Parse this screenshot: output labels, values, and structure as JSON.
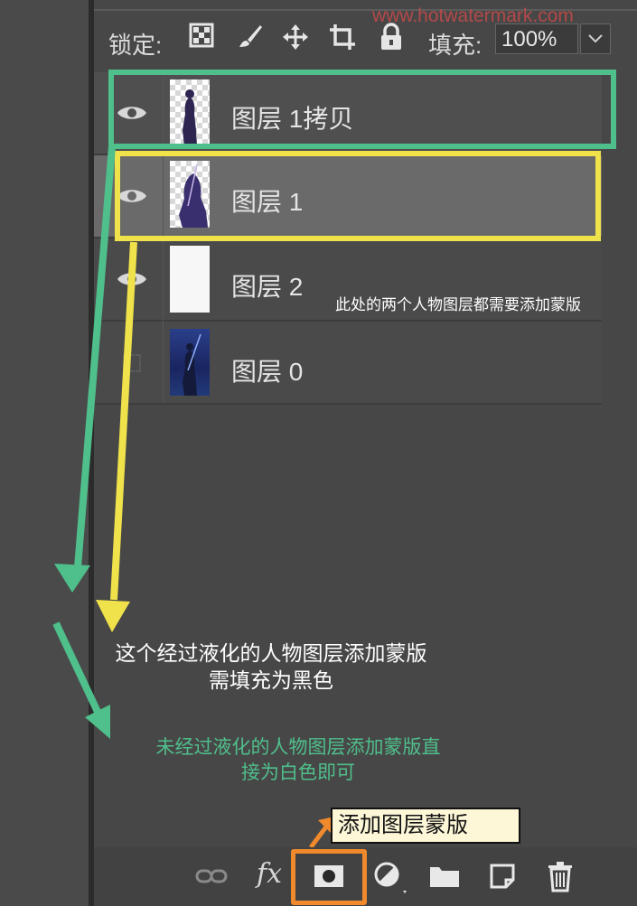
{
  "watermark": "www.hotwatermark.com",
  "lock_bar": {
    "lock_label": "锁定:",
    "fill_label": "填充:",
    "fill_value": "100%",
    "icons": [
      "lock-transparent-icon",
      "lock-brush-icon",
      "lock-move-icon",
      "lock-artboard-icon",
      "lock-all-icon"
    ]
  },
  "layers": [
    {
      "name": "图层 1拷贝",
      "visible": true,
      "thumb": "person-transparent"
    },
    {
      "name": "图层 1",
      "visible": true,
      "thumb": "person-transparent"
    },
    {
      "name": "图层 2",
      "visible": true,
      "thumb": "white"
    },
    {
      "name": "图层 0",
      "visible": false,
      "thumb": "photo"
    }
  ],
  "annotations": {
    "top_note": "此处的两个人物图层都需要添加蒙版",
    "yellow_note_line1": "这个经过液化的人物图层添加蒙版",
    "yellow_note_line2": "需填充为黑色",
    "green_note_line1": "未经过液化的人物图层添加蒙版直",
    "green_note_line2": "接为白色即可",
    "mask_tip": "添加图层蒙版"
  },
  "bottom_bar": {
    "icons": [
      "link-icon",
      "fx-icon",
      "add-mask-icon",
      "adjustment-icon",
      "folder-icon",
      "new-layer-icon",
      "trash-icon"
    ],
    "fx_label": "fx"
  },
  "colors": {
    "green": "#4fbf8b",
    "yellow": "#f0e24a",
    "orange": "#f08a2c",
    "watermark": "#e24a4a"
  }
}
